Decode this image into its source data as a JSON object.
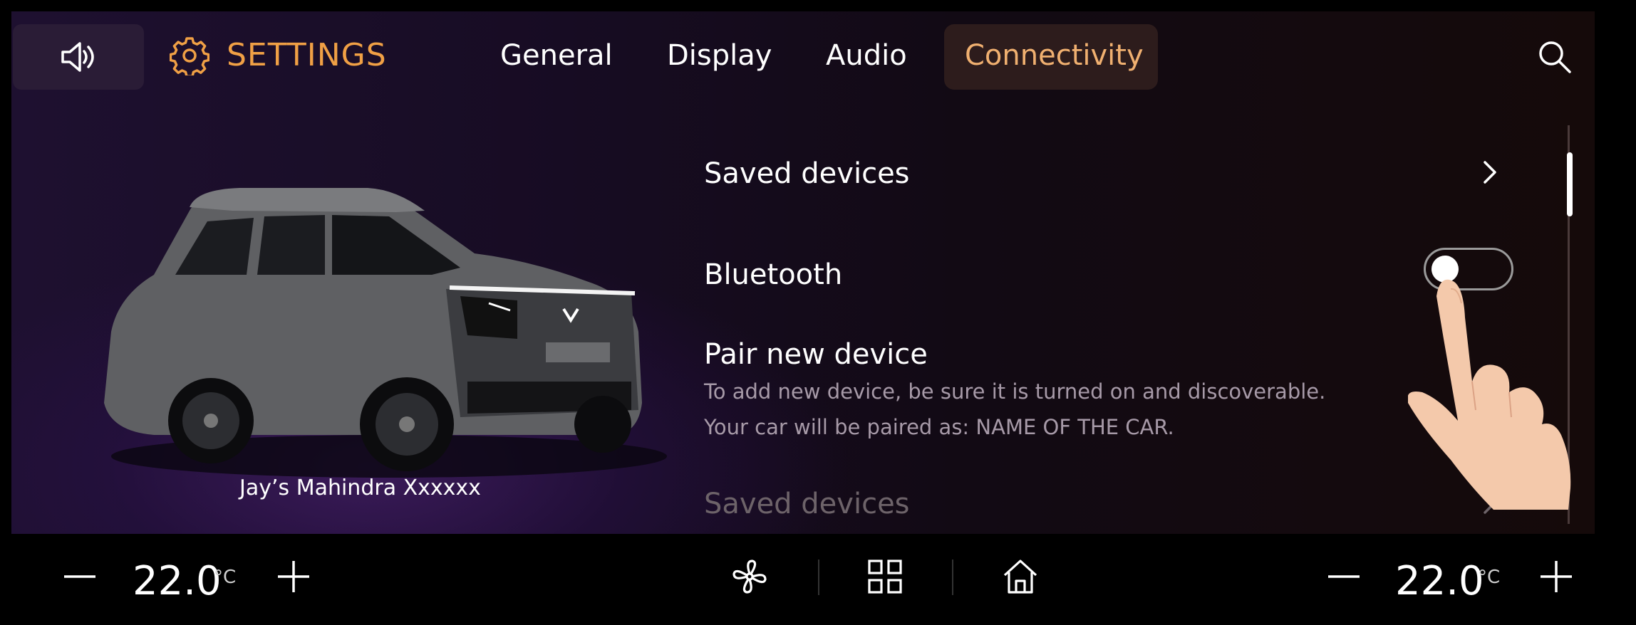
{
  "header": {
    "title": "SETTINGS",
    "tabs": [
      {
        "label": "General"
      },
      {
        "label": "Display"
      },
      {
        "label": "Audio"
      },
      {
        "label": "Connectivity",
        "active": true
      }
    ]
  },
  "vehicle": {
    "name": "Jay’s Mahindra Xxxxxx"
  },
  "connectivity": {
    "rows": [
      {
        "title": "Saved devices"
      },
      {
        "title": "Bluetooth",
        "toggle_on": false
      },
      {
        "title": "Pair new device",
        "line1": "To add new device, be sure it is turned on and discoverable.",
        "line2": "Your car will be paired as: NAME OF THE CAR."
      },
      {
        "title": "Saved devices"
      }
    ]
  },
  "climate": {
    "left": {
      "temp": "22.0",
      "unit": "°C"
    },
    "right": {
      "temp": "22.0",
      "unit": "°C"
    }
  },
  "colors": {
    "accent": "#f0a045",
    "active_tab_text": "#f0b070"
  },
  "icons": [
    "speaker-icon",
    "gear-icon",
    "search-icon",
    "chevron-right-icon",
    "fan-icon",
    "apps-grid-icon",
    "home-icon",
    "minus-icon",
    "plus-icon"
  ]
}
